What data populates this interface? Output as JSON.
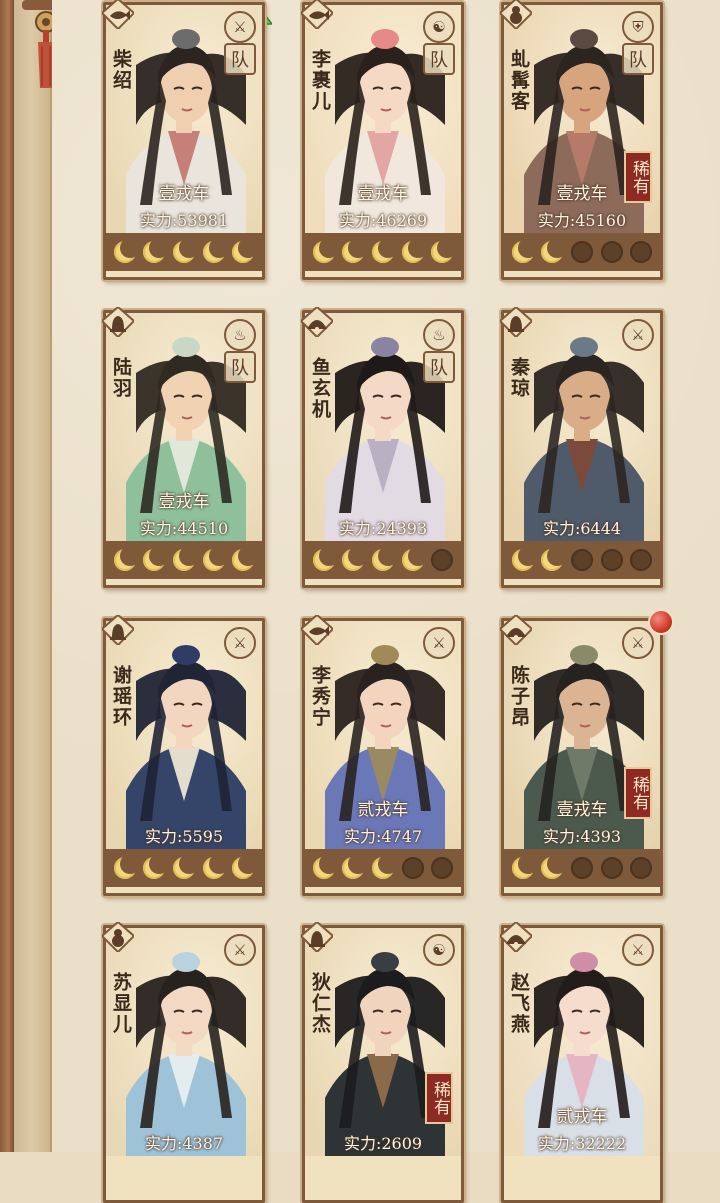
{
  "heroes": [
    {
      "name": "柴绍",
      "rank": "壹戎车",
      "power_label": "实力",
      "power": "53981",
      "stars": 5,
      "role": "sword",
      "team": "队",
      "rare": false,
      "portrait": "a",
      "camp": "fish"
    },
    {
      "name": "李裹儿",
      "rank": "壹戎车",
      "power_label": "实力",
      "power": "46269",
      "stars": 5,
      "role": "yinyang",
      "team": "队",
      "rare": false,
      "portrait": "b",
      "camp": "fish"
    },
    {
      "name": "虬髯客",
      "rank": "壹戎车",
      "power_label": "实力",
      "power": "45160",
      "stars": 2,
      "role": "shield",
      "team": "队",
      "rare": true,
      "rare_label": "稀有",
      "portrait": "c",
      "camp": "gourd"
    },
    {
      "name": "陆羽",
      "rank": "壹戎车",
      "power_label": "实力",
      "power": "44510",
      "stars": 5,
      "role": "cauldron",
      "team": "队",
      "rare": false,
      "portrait": "d",
      "camp": "bell"
    },
    {
      "name": "鱼玄机",
      "rank": "",
      "power_label": "实力",
      "power": "24393",
      "stars": 4,
      "role": "cauldron",
      "team": "队",
      "rare": false,
      "portrait": "e",
      "camp": "fan"
    },
    {
      "name": "秦琼",
      "rank": "",
      "power_label": "实力",
      "power": "6444",
      "stars": 2,
      "role": "sword",
      "team": "",
      "rare": false,
      "portrait": "f",
      "camp": "bell"
    },
    {
      "name": "谢瑶环",
      "rank": "",
      "power_label": "实力",
      "power": "5595",
      "stars": 5,
      "role": "sword",
      "team": "",
      "rare": false,
      "portrait": "g",
      "camp": "bell"
    },
    {
      "name": "李秀宁",
      "rank": "贰戎车",
      "power_label": "实力",
      "power": "4747",
      "stars": 3,
      "role": "sword",
      "team": "",
      "rare": false,
      "portrait": "h",
      "camp": "fish"
    },
    {
      "name": "陈子昂",
      "rank": "壹戎车",
      "power_label": "实力",
      "power": "4393",
      "stars": 2,
      "role": "sword",
      "team": "",
      "rare": true,
      "rare_label": "稀有",
      "portrait": "i",
      "camp": "fan"
    },
    {
      "name": "苏显儿",
      "rank": "",
      "power_label": "实力",
      "power": "4387",
      "stars": 0,
      "role": "sword",
      "team": "",
      "rare": false,
      "portrait": "j",
      "camp": "gourd"
    },
    {
      "name": "狄仁杰",
      "rank": "",
      "power_label": "实力",
      "power": "2609",
      "stars": 0,
      "role": "yinyang",
      "team": "",
      "rare": true,
      "rare_label": "稀有",
      "portrait": "k",
      "camp": "bell"
    },
    {
      "name": "赵飞燕",
      "rank": "贰戎车",
      "power_label": "实力",
      "power": "32222",
      "stars": 0,
      "role": "sword",
      "team": "",
      "rare": false,
      "portrait": "l",
      "camp": "fan"
    }
  ],
  "colors": {
    "rare": "#8e2a22",
    "frame": "#7e5a3a",
    "moon_on": "#f4d77a"
  }
}
